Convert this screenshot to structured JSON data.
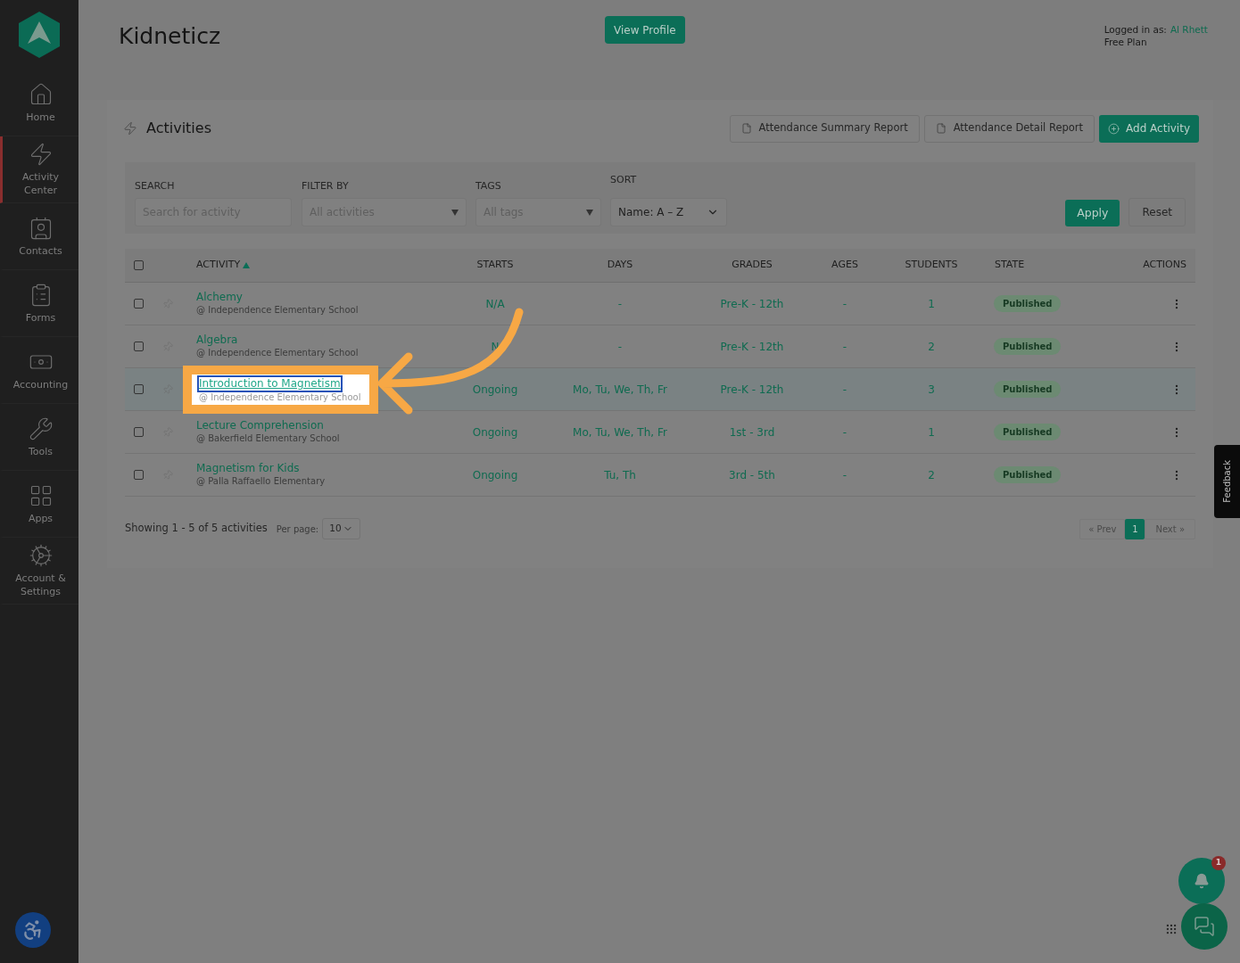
{
  "sidebar": {
    "items": [
      {
        "kind": "home",
        "label": "Home",
        "selected": false
      },
      {
        "kind": "activity",
        "label": "Activity Center",
        "selected": true
      },
      {
        "kind": "contacts",
        "label": "Contacts",
        "selected": false
      },
      {
        "kind": "forms",
        "label": "Forms",
        "selected": false
      },
      {
        "kind": "accounting",
        "label": "Accounting",
        "selected": false
      },
      {
        "kind": "tools",
        "label": "Tools",
        "selected": false
      },
      {
        "kind": "apps",
        "label": "Apps",
        "selected": false
      },
      {
        "kind": "settings",
        "label": "Account & Settings",
        "selected": false
      }
    ]
  },
  "header": {
    "title": "Kidneticz",
    "view_profile": "View Profile",
    "logged_in_label": "Logged in as:",
    "user": "Al Rhett",
    "plan": "Free Plan"
  },
  "activities": {
    "title": "Activities",
    "report_buttons": [
      "Attendance Summary Report",
      "Attendance Detail Report"
    ],
    "add_button": "Add Activity"
  },
  "filters": {
    "search_label": "SEARCH",
    "search_placeholder": "Search for activity",
    "filter_label": "FILTER BY",
    "filter_placeholder": "All activities",
    "tags_label": "TAGS",
    "tags_placeholder": "All tags",
    "sort_label": "SORT",
    "sort_value": "Name: A – Z",
    "apply": "Apply",
    "reset": "Reset"
  },
  "table": {
    "select_all_checked": false,
    "columns": [
      "ACTIVITY",
      "STARTS",
      "DAYS",
      "GRADES",
      "AGES",
      "STUDENTS",
      "STATE",
      "ACTIONS"
    ],
    "rows": [
      {
        "name": "Alchemy",
        "location": "@ Independence Elementary School",
        "starts": "N/A",
        "days": "-",
        "grades": "Pre-K - 12th",
        "ages": "-",
        "students": "1",
        "state": "Published",
        "highlighted": false
      },
      {
        "name": "Algebra",
        "location": "@ Independence Elementary School",
        "starts": "N",
        "days": "-",
        "grades": "Pre-K - 12th",
        "ages": "-",
        "students": "2",
        "state": "Published",
        "highlighted": false
      },
      {
        "name": "Introduction to Magnetism",
        "location": "@ Independence Elementary School",
        "starts": "Ongoing",
        "days": "Mo, Tu, We, Th, Fr",
        "grades": "Pre-K - 12th",
        "ages": "-",
        "students": "3",
        "state": "Published",
        "highlighted": true
      },
      {
        "name": "Lecture Comprehension",
        "location": "@ Bakerfield Elementary School",
        "starts": "Ongoing",
        "days": "Mo, Tu, We, Th, Fr",
        "grades": "1st - 3rd",
        "ages": "-",
        "students": "1",
        "state": "Published",
        "highlighted": false
      },
      {
        "name": "Magnetism for Kids",
        "location": "@ Palla Raffaello Elementary",
        "starts": "Ongoing",
        "days": "Tu, Th",
        "grades": "3rd - 5th",
        "ages": "-",
        "students": "2",
        "state": "Published",
        "highlighted": false
      }
    ]
  },
  "footer": {
    "showing": "Showing 1 - 5 of 5 activities",
    "per_page_label": "Per page:",
    "per_page": "10",
    "prev": "« Prev",
    "pages": [
      {
        "label": "1",
        "selected": true
      }
    ],
    "next": "Next »"
  },
  "feedback": "Feedback",
  "notification_count": "1"
}
